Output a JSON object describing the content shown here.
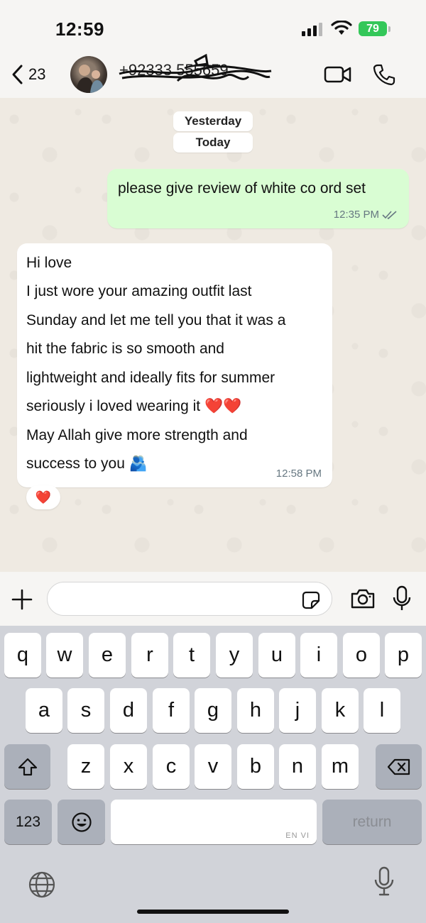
{
  "status_bar": {
    "time": "12:59",
    "battery": "79"
  },
  "header": {
    "back_count": "23",
    "contact_name": "+92333 555659"
  },
  "chat": {
    "date_pills": [
      "Yesterday",
      "Today"
    ],
    "outgoing": {
      "text": "please give review of white co ord set",
      "time": "12:35 PM"
    },
    "incoming": {
      "lines": [
        "Hi love",
        "I just wore your amazing outfit last",
        "Sunday and let me tell you that it was a",
        "hit the fabric is so smooth and",
        "lightweight and ideally fits for summer",
        "seriously i loved wearing it ❤️❤️",
        "May Allah give more strength and",
        "success to you 🫂"
      ],
      "time": "12:58 PM",
      "reaction": "❤️"
    }
  },
  "input": {
    "placeholder": ""
  },
  "keyboard": {
    "row1": [
      "q",
      "w",
      "e",
      "r",
      "t",
      "y",
      "u",
      "i",
      "o",
      "p"
    ],
    "row2": [
      "a",
      "s",
      "d",
      "f",
      "g",
      "h",
      "j",
      "k",
      "l"
    ],
    "row3": [
      "z",
      "x",
      "c",
      "v",
      "b",
      "n",
      "m"
    ],
    "numbers_label": "123",
    "space_lang": "EN VI",
    "return_label": "return"
  },
  "colors": {
    "outgoing_bubble": "#d9fdd3",
    "incoming_bubble": "#ffffff",
    "battery": "#34c759"
  }
}
